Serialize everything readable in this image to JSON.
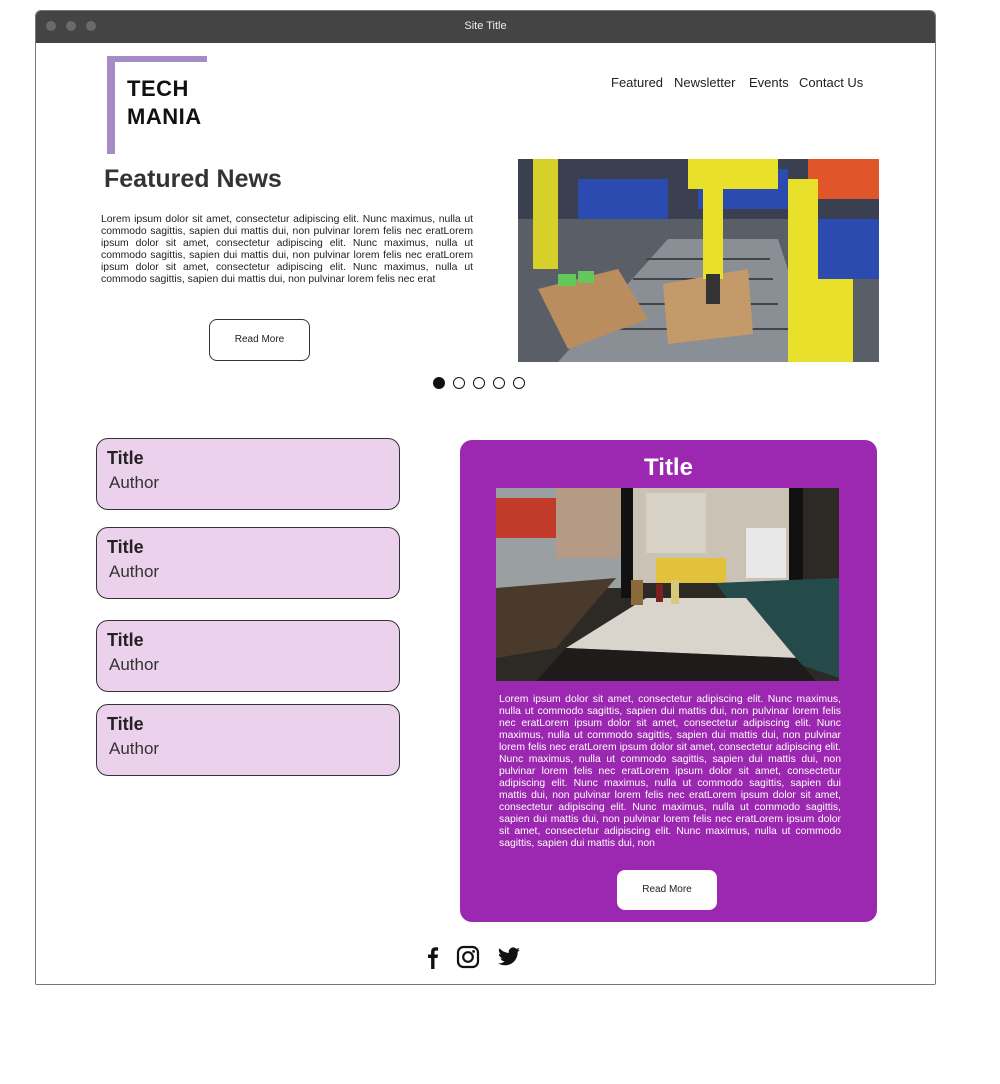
{
  "window": {
    "title": "Site Title"
  },
  "logo": {
    "line1": "TECH",
    "line2": "MANIA"
  },
  "nav": {
    "items": [
      "Featured",
      "Newsletter",
      "Events",
      "Contact Us"
    ]
  },
  "featured": {
    "heading": "Featured News",
    "body": "Lorem ipsum dolor sit amet, consectetur adipiscing elit. Nunc maximus, nulla ut commodo sagittis, sapien dui mattis dui, non pulvinar lorem felis nec eratLorem ipsum dolor sit amet, consectetur adipiscing elit. Nunc maximus, nulla ut commodo sagittis, sapien dui mattis dui, non pulvinar lorem felis nec eratLorem ipsum dolor sit amet, consectetur adipiscing elit. Nunc maximus, nulla ut commodo sagittis, sapien dui mattis dui, non pulvinar lorem felis nec erat",
    "button": "Read More",
    "image_icon": "robot-arm-photo"
  },
  "carousel": {
    "count": 5,
    "active_index": 1
  },
  "articles": [
    {
      "title": "Title",
      "author": "Author"
    },
    {
      "title": "Title",
      "author": "Author"
    },
    {
      "title": "Title",
      "author": "Author"
    },
    {
      "title": "Title",
      "author": "Author"
    }
  ],
  "feature_card": {
    "title": "Title",
    "image_icon": "diner-booth-photo",
    "body": "Lorem ipsum dolor sit amet, consectetur adipiscing elit. Nunc maximus, nulla ut commodo sagittis, sapien dui mattis dui, non pulvinar lorem felis nec eratLorem ipsum dolor sit amet, consectetur adipiscing elit. Nunc maximus, nulla ut commodo sagittis, sapien dui mattis dui, non pulvinar lorem felis nec eratLorem ipsum dolor sit amet, consectetur adipiscing elit. Nunc maximus, nulla ut commodo sagittis, sapien dui mattis dui, non pulvinar lorem felis nec eratLorem ipsum dolor sit amet, consectetur adipiscing elit. Nunc maximus, nulla ut commodo sagittis, sapien dui mattis dui, non pulvinar lorem felis nec eratLorem ipsum dolor sit amet, consectetur adipiscing elit. Nunc maximus, nulla ut commodo sagittis, sapien dui mattis dui, non pulvinar lorem felis nec eratLorem ipsum dolor sit amet, consectetur adipiscing elit. Nunc maximus, nulla ut commodo sagittis, sapien dui mattis dui, non",
    "button": "Read More"
  },
  "social": [
    "facebook-icon",
    "instagram-icon",
    "twitter-icon"
  ],
  "colors": {
    "accent": "#9c27b0",
    "card_bg": "#ecd1ec",
    "logo": "#a58cc6",
    "titlebar": "#444444"
  }
}
